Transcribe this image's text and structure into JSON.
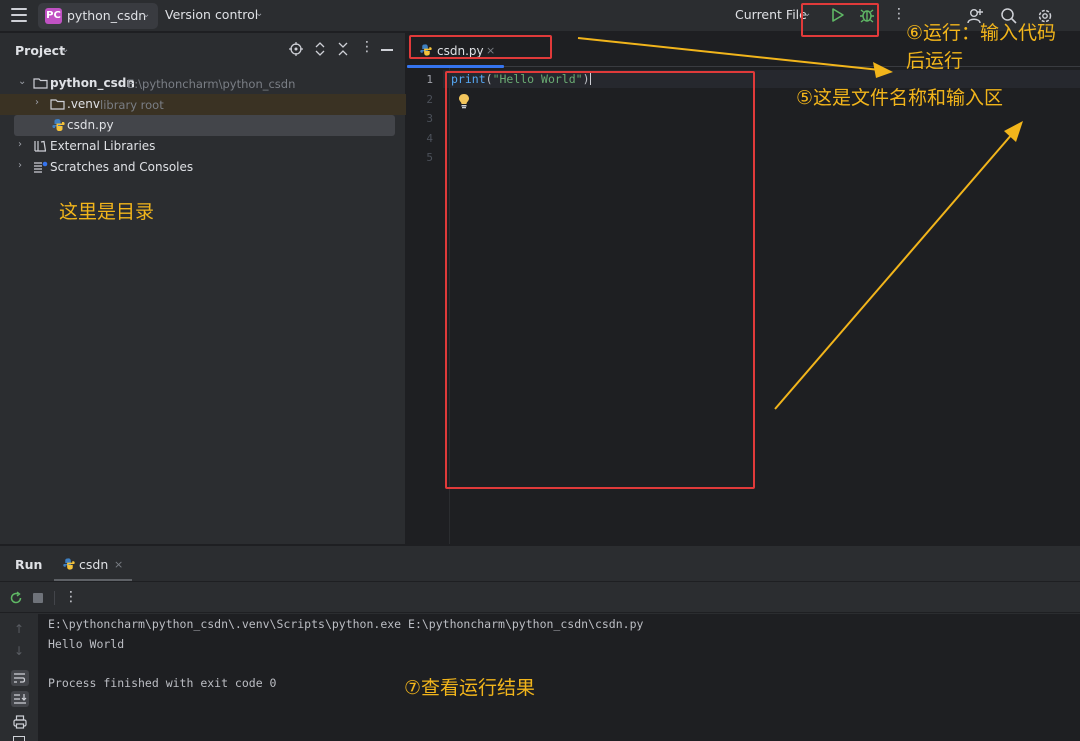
{
  "titlebar": {
    "project_badge": "PC",
    "project_name": "python_csdn",
    "vcs_label": "Version control",
    "run_config": "Current File"
  },
  "project_panel": {
    "title": "Project",
    "tree": [
      {
        "label": "python_csdn",
        "path": "E:\\pythoncharm\\python_csdn"
      },
      {
        "label": ".venv",
        "note": "library root"
      },
      {
        "label": "csdn.py"
      },
      {
        "label": "External Libraries"
      },
      {
        "label": "Scratches and Consoles"
      }
    ]
  },
  "editor": {
    "tab_label": "csdn.py",
    "line_numbers": [
      "1",
      "2",
      "3",
      "4",
      "5"
    ],
    "code": {
      "func": "print",
      "open": "(",
      "str": "\"Hello World\"",
      "close": ")"
    }
  },
  "run_panel": {
    "title": "Run",
    "tab_label": "csdn",
    "console": [
      "E:\\pythoncharm\\python_csdn\\.venv\\Scripts\\python.exe E:\\pythoncharm\\python_csdn\\csdn.py",
      "Hello World",
      "",
      "Process finished with exit code 0"
    ]
  },
  "annotations": {
    "directory": "这里是目录",
    "run_line1": "⑥运行：输入代码",
    "run_line2": "后运行",
    "file_area": "⑤这是文件名称和输入区",
    "result": "⑦查看运行结果"
  },
  "colors": {
    "accent_blue": "#3574f0",
    "run_green": "#5fb865",
    "annotation": "#f2b51b",
    "highlight_red": "#e03a3a",
    "badge_purple": "#c152c4"
  }
}
